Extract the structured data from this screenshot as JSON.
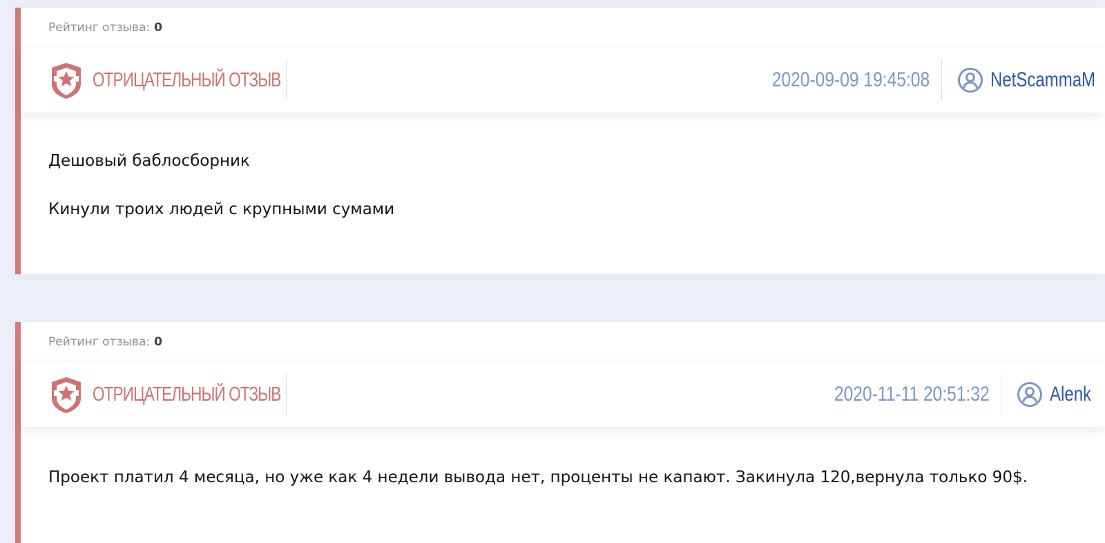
{
  "reviews": [
    {
      "rating_label": "Рейтинг отзыва:",
      "rating_value": "0",
      "type_label": "ОТРИЦАТЕЛЬНЫЙ ОТЗЫВ",
      "icon": "shield-star-icon",
      "date": "2020-09-09 19:45:08",
      "author": "NetScammaM",
      "text_lines": [
        "Дешовый баблосборник",
        "Кинули троих людей с крупными сумами"
      ]
    },
    {
      "rating_label": "Рейтинг отзыва:",
      "rating_value": "0",
      "type_label": "ОТРИЦАТЕЛЬНЫЙ ОТЗЫВ",
      "icon": "shield-star-icon",
      "date": "2020-11-11 20:51:32",
      "author": "Alenk",
      "text_lines": [
        "Проект платил 4 месяца, но уже как 4 недели вывода нет, проценты не капают. Закинула 120,вернула только 90$."
      ]
    }
  ],
  "colors": {
    "page_bg": "#eceff7",
    "negative_accent": "#d27b7b",
    "date_color": "#7c97c6",
    "author_color": "#2e5aa8"
  }
}
